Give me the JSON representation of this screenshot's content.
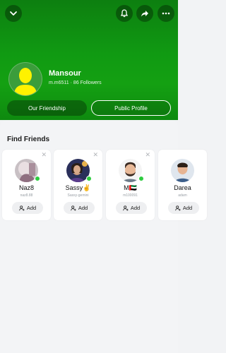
{
  "profile": {
    "name": "Mansour",
    "username": "m.m6511",
    "separator": "·",
    "followers": "86 Followers"
  },
  "buttons": {
    "friendship": "Our Friendship",
    "public_profile": "Public Profile"
  },
  "find_friends": {
    "title": "Find Friends",
    "close_glyph": "✕",
    "cards": [
      {
        "name": "Naz8",
        "username": "naz8.88",
        "add_label": "Add"
      },
      {
        "name": "Sassy✌",
        "username": "Sassy-gemini",
        "add_label": "Add"
      },
      {
        "name": "M🇦🇪",
        "username": "m100091",
        "add_label": "Add"
      },
      {
        "name": "Darea",
        "username": "adam",
        "add_label": "Add"
      }
    ]
  },
  "colors": {
    "header_green": "#109a12",
    "online_dot": "#2ecc40",
    "bitmoji_yellow": "#fff200"
  },
  "icons": [
    "chevron-down-icon",
    "bell-icon",
    "share-icon",
    "more-icon",
    "add-friend-icon",
    "close-icon"
  ]
}
